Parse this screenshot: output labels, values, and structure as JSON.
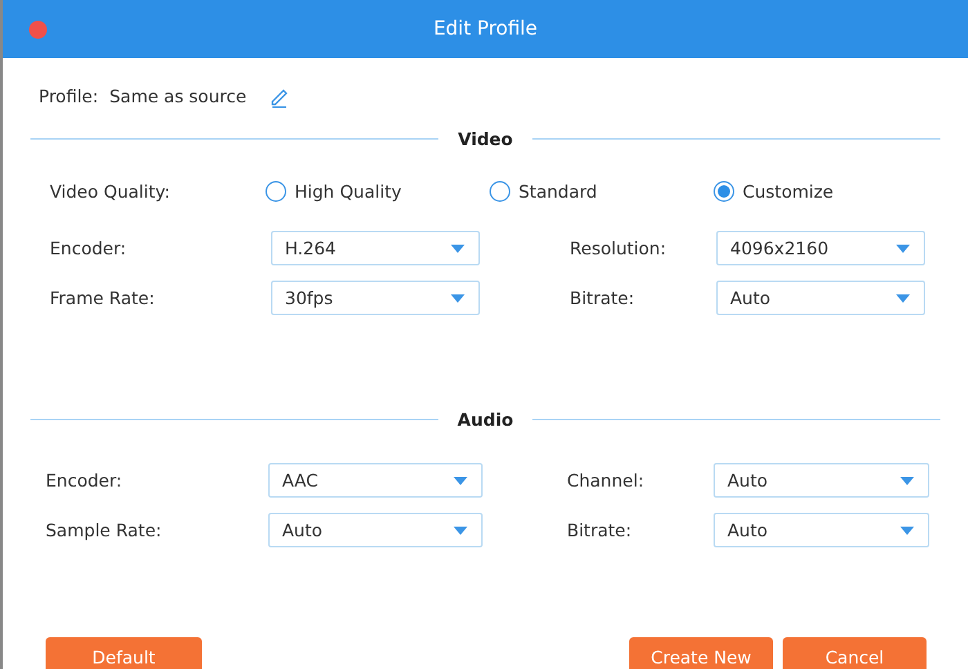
{
  "window": {
    "title": "Edit Profile"
  },
  "profile": {
    "label": "Profile:",
    "value": "Same as source"
  },
  "video": {
    "heading": "Video",
    "quality_label": "Video Quality:",
    "quality_options": [
      {
        "label": "High Quality",
        "selected": false
      },
      {
        "label": "Standard",
        "selected": false
      },
      {
        "label": "Customize",
        "selected": true
      }
    ],
    "fields": [
      {
        "label": "Encoder:",
        "value": "H.264"
      },
      {
        "label": "Resolution:",
        "value": "4096x2160"
      },
      {
        "label": "Frame Rate:",
        "value": "30fps"
      },
      {
        "label": "Bitrate:",
        "value": "Auto"
      }
    ]
  },
  "audio": {
    "heading": "Audio",
    "fields": [
      {
        "label": "Encoder:",
        "value": "AAC"
      },
      {
        "label": "Channel:",
        "value": "Auto"
      },
      {
        "label": "Sample Rate:",
        "value": "Auto"
      },
      {
        "label": "Bitrate:",
        "value": "Auto"
      }
    ]
  },
  "buttons": {
    "left": [
      "Default"
    ],
    "right": [
      "Create New",
      "Cancel"
    ]
  }
}
